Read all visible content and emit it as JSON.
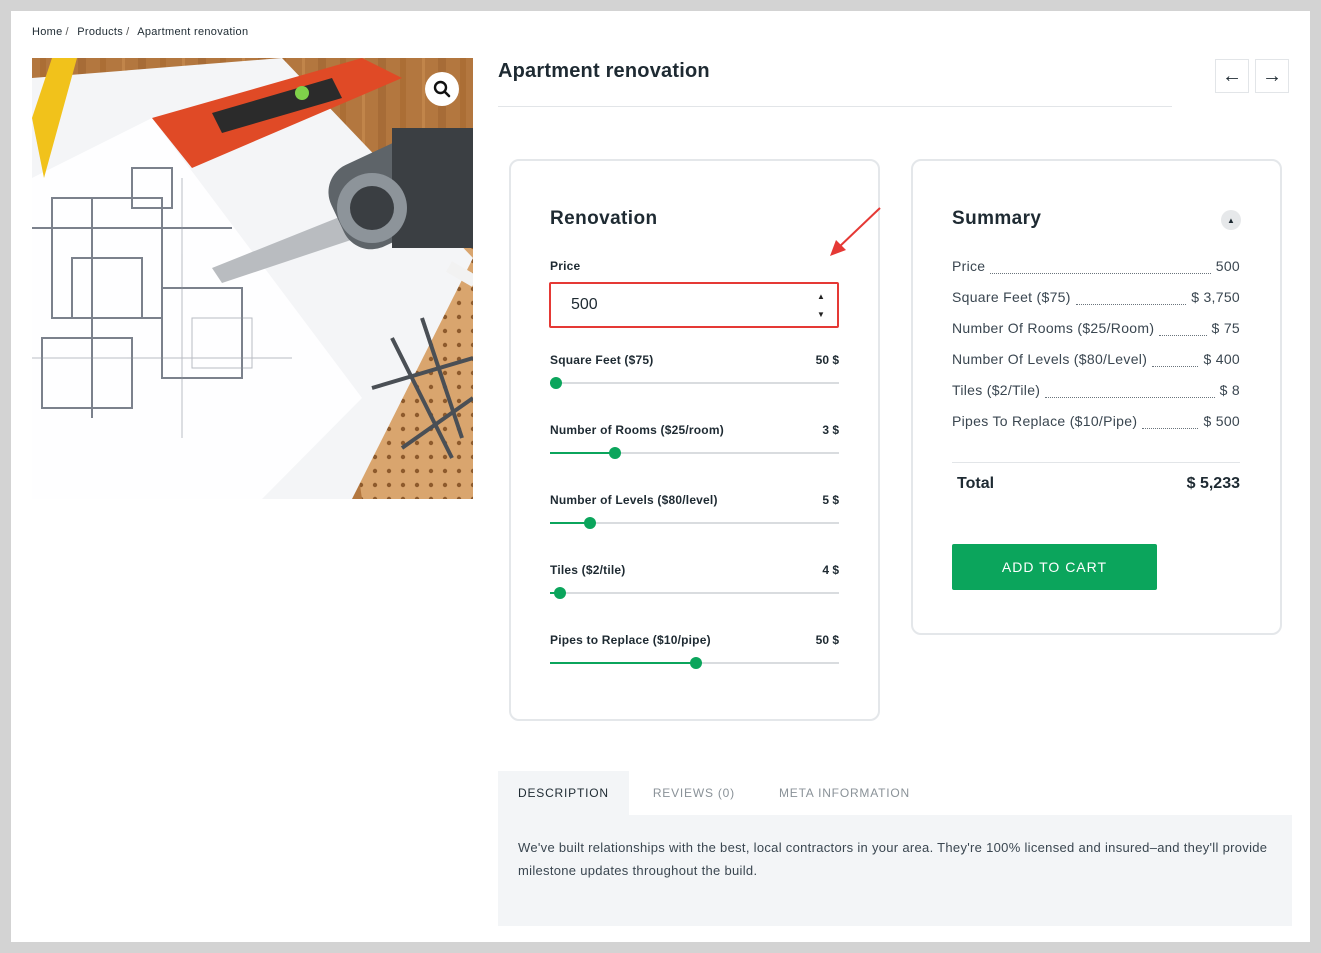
{
  "breadcrumb": {
    "home": "Home",
    "products": "Products",
    "current": "Apartment renovation",
    "separator": "/"
  },
  "product": {
    "title": "Apartment renovation"
  },
  "nav": {
    "prev": "←",
    "next": "→"
  },
  "renovation": {
    "title": "Renovation",
    "price_label": "Price",
    "price_value": "500",
    "sliders": [
      {
        "label": "Square Feet ($75)",
        "value": "50 $",
        "fraction": 0.02
      },
      {
        "label": "Number of Rooms ($25/room)",
        "value": "3 $",
        "fraction": 0.225
      },
      {
        "label": "Number of Levels ($80/level)",
        "value": "5 $",
        "fraction": 0.14
      },
      {
        "label": "Tiles ($2/tile)",
        "value": "4 $",
        "fraction": 0.035
      },
      {
        "label": "Pipes to Replace ($10/pipe)",
        "value": "50 $",
        "fraction": 0.505
      }
    ]
  },
  "summary": {
    "title": "Summary",
    "rows": [
      {
        "label": "Price",
        "value": "500"
      },
      {
        "label": "Square Feet ($75)",
        "value": "$ 3,750"
      },
      {
        "label": "Number Of Rooms ($25/Room)",
        "value": "$ 75"
      },
      {
        "label": "Number Of Levels ($80/Level)",
        "value": "$ 400"
      },
      {
        "label": "Tiles ($2/Tile)",
        "value": "$ 8"
      },
      {
        "label": "Pipes To Replace ($10/Pipe)",
        "value": "$ 500"
      }
    ],
    "total_label": "Total",
    "total_value": "$ 5,233",
    "add_to_cart": "ADD TO CART"
  },
  "tabs": [
    {
      "label": "DESCRIPTION"
    },
    {
      "label": "REVIEWS (0)"
    },
    {
      "label": "META INFORMATION"
    }
  ],
  "description": "We've built relationships with the best, local contractors in your area. They're 100% licensed and insured–and they'll provide milestone updates throughout the build.",
  "colors": {
    "accent": "#0ba55c",
    "highlight": "#e53935",
    "text": "#1e2a32"
  }
}
